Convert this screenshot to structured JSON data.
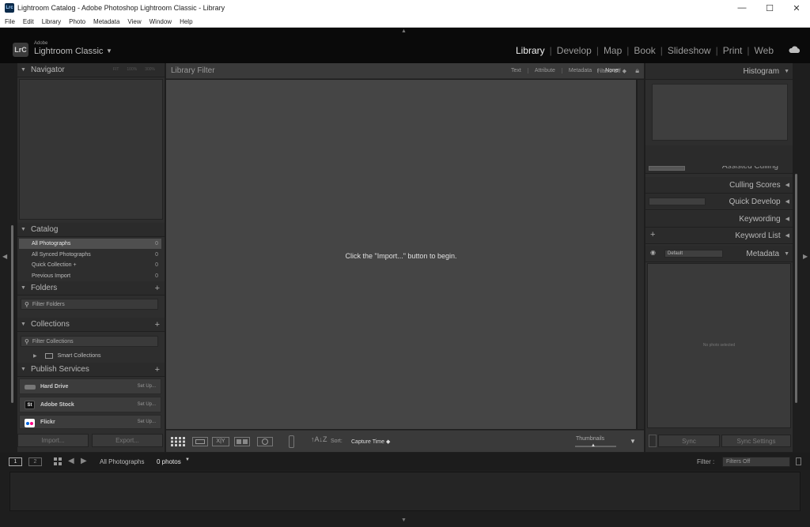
{
  "window": {
    "title": "Lightroom Catalog - Adobe Photoshop Lightroom Classic - Library",
    "app_icon": "Lrc",
    "controls": {
      "minimize": "—",
      "maximize": "☐",
      "close": "✕"
    }
  },
  "menu": [
    "File",
    "Edit",
    "Library",
    "Photo",
    "Metadata",
    "View",
    "Window",
    "Help"
  ],
  "brand": {
    "logo": "LrC",
    "company": "Adobe",
    "product": "Lightroom Classic"
  },
  "modules": [
    "Library",
    "Develop",
    "Map",
    "Book",
    "Slideshow",
    "Print",
    "Web"
  ],
  "active_module": "Library",
  "left": {
    "navigator": {
      "title": "Navigator",
      "zoom": [
        "FIT",
        "100%",
        "300%"
      ]
    },
    "catalog": {
      "title": "Catalog",
      "items": [
        {
          "label": "All Photographs",
          "count": "0"
        },
        {
          "label": "All Synced Photographs",
          "count": "0"
        },
        {
          "label": "Quick Collection +",
          "count": "0"
        },
        {
          "label": "Previous Import",
          "count": "0"
        }
      ]
    },
    "folders": {
      "title": "Folders",
      "filter": "Filter Folders"
    },
    "collections": {
      "title": "Collections",
      "filter": "Filter Collections",
      "smart": "Smart Collections"
    },
    "publish": {
      "title": "Publish Services",
      "services": [
        {
          "label": "Hard Drive",
          "action": "Set Up..."
        },
        {
          "label": "Adobe Stock",
          "action": "Set Up...",
          "icon": "St"
        },
        {
          "label": "Flickr",
          "action": "Set Up..."
        }
      ]
    },
    "import_label": "Import...",
    "export_label": "Export..."
  },
  "filter_bar": {
    "title": "Library Filter",
    "tabs": [
      "Text",
      "Attribute",
      "Metadata",
      "None"
    ],
    "status": "Filters Off ◆"
  },
  "grid": {
    "message": "Click the \"Import...\" button to begin."
  },
  "toolbar": {
    "sort_label": "Sort:",
    "sort_value": "Capture Time ◆",
    "thumbnails_label": "Thumbnails"
  },
  "right": {
    "histogram": "Histogram",
    "panels": [
      "Culling Scores",
      "Quick Develop",
      "Keywording",
      "Keyword List",
      "Metadata"
    ],
    "hidden_panel": "Assisted Culling",
    "metadata_preset": "Default",
    "no_photo": "No photo selected",
    "sync_label": "Sync",
    "sync_settings_label": "Sync Settings"
  },
  "filmstrip": {
    "view1": "1",
    "view2": "2",
    "source": "All Photographs",
    "count": "0 photos",
    "filter_label": "Filter :",
    "filter_value": "Filters Off"
  },
  "colors": {
    "active_module": "#f0f0f0",
    "panel_bg": "#2e2e2e",
    "grid_bg": "#454545",
    "stock_icon": "#1a1a1a",
    "flickr_blue": "#0063dc",
    "flickr_pink": "#ff0084"
  }
}
